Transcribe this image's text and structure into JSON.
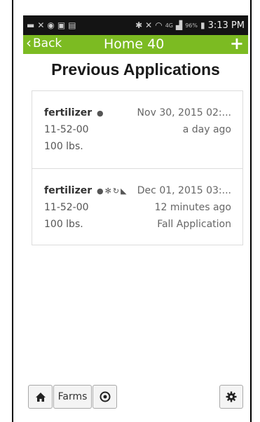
{
  "status_bar": {
    "left_icons": [
      "message-icon",
      "missed-call-icon",
      "sync-icon",
      "gallery-icon",
      "screenshot-icon"
    ],
    "bluetooth_icon": "bluetooth-icon",
    "mute_icon": "mute-icon",
    "wifi_icon": "wifi-icon",
    "signal_badge": "4G",
    "battery_percent": "96%",
    "time": "3:13 PM"
  },
  "nav": {
    "back_label": "Back",
    "title": "Home 40",
    "add_label": "+"
  },
  "page": {
    "title": "Previous Applications"
  },
  "applications": [
    {
      "name": "fertilizer",
      "icons": "drop",
      "date": "Nov 30, 2015 02:...",
      "product": "11-52-00",
      "relative_time": "a day ago",
      "amount": "100 lbs.",
      "note": ""
    },
    {
      "name": "fertilizer",
      "icons": "drop-snow-recycle-leaf",
      "date": "Dec 01, 2015 03:...",
      "product": "11-52-00",
      "relative_time": "12 minutes ago",
      "amount": "100 lbs.",
      "note": "Fall Application"
    }
  ],
  "bottom_bar": {
    "home_icon": "home-icon",
    "farms_label": "Farms",
    "location_icon": "location-target-icon",
    "settings_icon": "gear-icon"
  },
  "colors": {
    "nav_bar": "#7cbb22",
    "status_bar": "#141414"
  }
}
